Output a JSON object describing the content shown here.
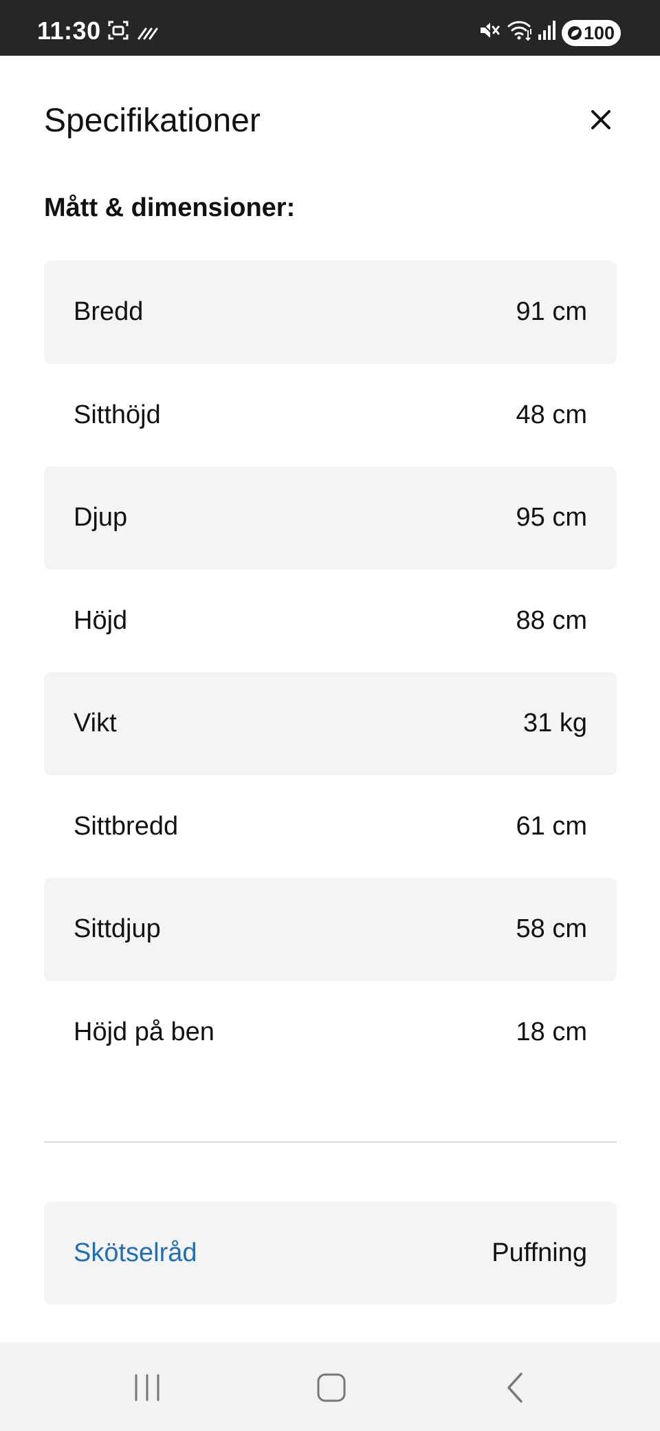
{
  "status_bar": {
    "time": "11:30",
    "battery": "100"
  },
  "header": {
    "title": "Specifikationer",
    "close_icon": "close-icon"
  },
  "dimensions": {
    "heading": "Mått & dimensioner:",
    "rows": [
      {
        "label": "Bredd",
        "value": "91 cm"
      },
      {
        "label": "Sitthöjd",
        "value": "48 cm"
      },
      {
        "label": "Djup",
        "value": "95 cm"
      },
      {
        "label": "Höjd",
        "value": "88 cm"
      },
      {
        "label": "Vikt",
        "value": "31 kg"
      },
      {
        "label": "Sittbredd",
        "value": "61 cm"
      },
      {
        "label": "Sittdjup",
        "value": "58 cm"
      },
      {
        "label": "Höjd på ben",
        "value": "18 cm"
      }
    ]
  },
  "care": {
    "link_label": "Skötselråd",
    "value": "Puffning"
  },
  "colors": {
    "link": "#1f6fb6",
    "row_shade": "#f4f4f4",
    "status_bar": "#262626",
    "nav_bar": "#f2f2f2"
  },
  "nav": {
    "recent_icon": "recent-apps-icon",
    "home_icon": "home-icon",
    "back_icon": "back-icon"
  }
}
